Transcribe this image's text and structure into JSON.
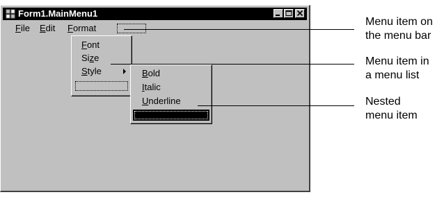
{
  "window": {
    "title": "Form1.MainMenu1",
    "icon": "form-app-icon"
  },
  "menubar": {
    "file": {
      "mnemonic": "F",
      "rest": "ile"
    },
    "edit": {
      "mnemonic": "E",
      "rest": "dit"
    },
    "format": {
      "mnemonic": "F",
      "rest": "ormat"
    }
  },
  "format_menu": {
    "font": {
      "pre": "",
      "mnemonic": "F",
      "rest": "ont"
    },
    "size": {
      "pre": "Si",
      "mnemonic": "z",
      "rest": "e"
    },
    "style": {
      "pre": "",
      "mnemonic": "S",
      "rest": "tyle"
    }
  },
  "style_menu": {
    "bold": {
      "mnemonic": "B",
      "rest": "old"
    },
    "italic": {
      "mnemonic": "I",
      "rest": "talic"
    },
    "underline": {
      "mnemonic": "U",
      "rest": "nderline"
    }
  },
  "callouts": {
    "menubar_item": {
      "line1": "Menu item on",
      "line2": "the menu bar"
    },
    "menulist_item": {
      "line1": "Menu item in",
      "line2": "a menu list"
    },
    "nested_item": {
      "line1": "Nested",
      "line2": "menu item"
    }
  },
  "colors": {
    "face": "#c0c0c0",
    "titlebar": "#000000",
    "selection": "#000000"
  }
}
